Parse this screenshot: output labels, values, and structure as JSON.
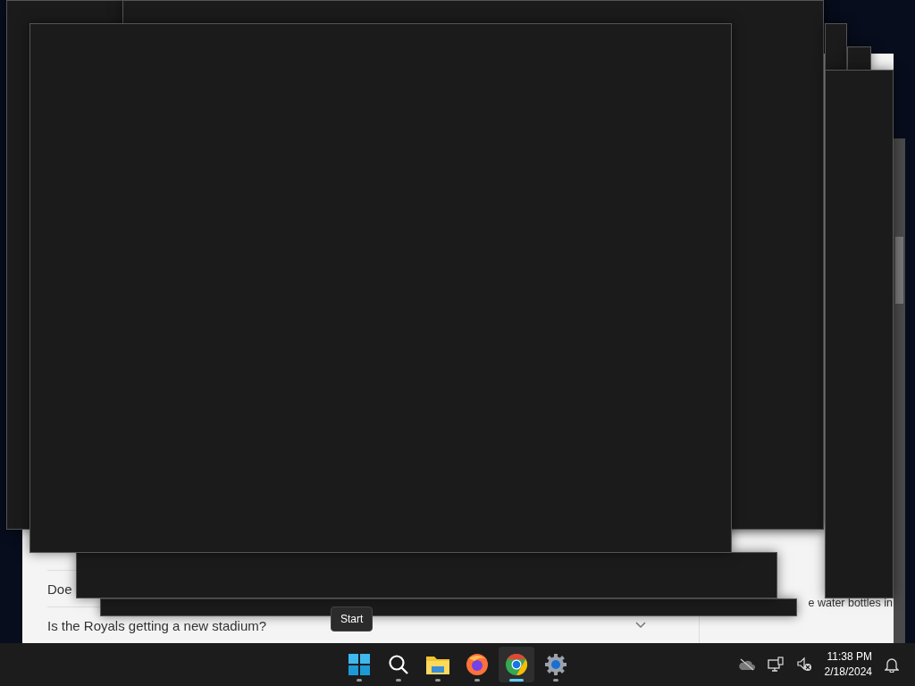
{
  "page": {
    "faq": [
      {
        "question": "Doe"
      },
      {
        "question": "Is the Royals getting a new stadium?"
      }
    ],
    "side_text": "e water bottles in"
  },
  "tooltip": "Start",
  "taskbar": {
    "apps": [
      {
        "kind": "start",
        "selected": false
      },
      {
        "kind": "search",
        "selected": false
      },
      {
        "kind": "files",
        "selected": false
      },
      {
        "kind": "firefox",
        "selected": false
      },
      {
        "kind": "chrome",
        "selected": true
      },
      {
        "kind": "settings",
        "selected": false
      }
    ],
    "time": "11:38 PM",
    "date": "2/18/2024"
  }
}
